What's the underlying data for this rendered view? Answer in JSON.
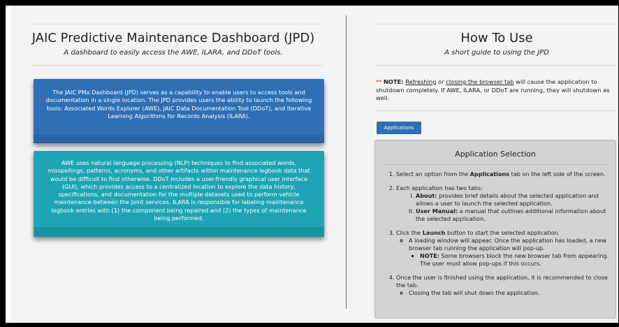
{
  "left": {
    "title": "JAIC Predictive Maintenance Dashboard (JPD)",
    "subtitle": "A dashboard to easily access the AWE, ILARA, and DDoT tools.",
    "intro_box": "The JAIC PMx Dashboard (JPD) serves as a capability to enable users to access tools and documentation in a single location. The JPD provides users the ability to launch the following tools: Associated Words Explorer (AWE), JAIC Data Documentation Tool (DDoT), and Iterative Learning Algorithms for Records Analysis (ILARA).",
    "detail_box": "AWE uses natural language processing (NLP) techniques to find associated words, misspellings, patterns, acronyms, and other artifacts within maintenance logbook data that would be difficult to find otherwise. DDoT includes a user-friendly graphical user interface (GUI), which provides access to a centralized location to explore the data history, specifications, and documentation for the multiple datasets used to perform vehicle maintenance between the Joint services. ILARA is responsible for labeling maintenance logbook entries with (1) the component being repaired and (2) the types of maintenance being performed."
  },
  "right": {
    "title": "How To Use",
    "subtitle": "A short guide to using the JPD",
    "note": {
      "stars": "**",
      "label": "NOTE:",
      "link_refresh": "Refreshing",
      "or": "or",
      "link_close": "closing the browser tab",
      "rest": "will cause the application to shutdown completely. If AWE, ILARA, or DDoT are running, they will shutdown as well."
    },
    "tab_label": "Applications",
    "panel": {
      "title": "Application Selection",
      "step1_pre": "Select an option from the",
      "step1_bold": "Applications",
      "step1_post": "tab on the left side of the screen.",
      "step2": "Each application has two tabs:",
      "step2_about_bold": "About:",
      "step2_about": "provides brief details about the selected application and allows a user to launch the selected application.",
      "step2_manual_bold": "User Manual:",
      "step2_manual": "a manual that outlines additional information about the selected application.",
      "step3_pre": "Click the",
      "step3_bold": "Launch",
      "step3_post": "button to start the selected application.",
      "step3_sub": "A loading window will appear. Once the application has loaded, a new browser tab running the application will pop-up.",
      "step3_note_bold": "NOTE:",
      "step3_note": "Some browsers block the new browser tab from appearing. The user must allow pop-ups if this occurs.",
      "step4": "Once the user is finished using the application, it is recommended to close the tab.",
      "step4_sub": "Closing the tab will shut down the application."
    }
  }
}
